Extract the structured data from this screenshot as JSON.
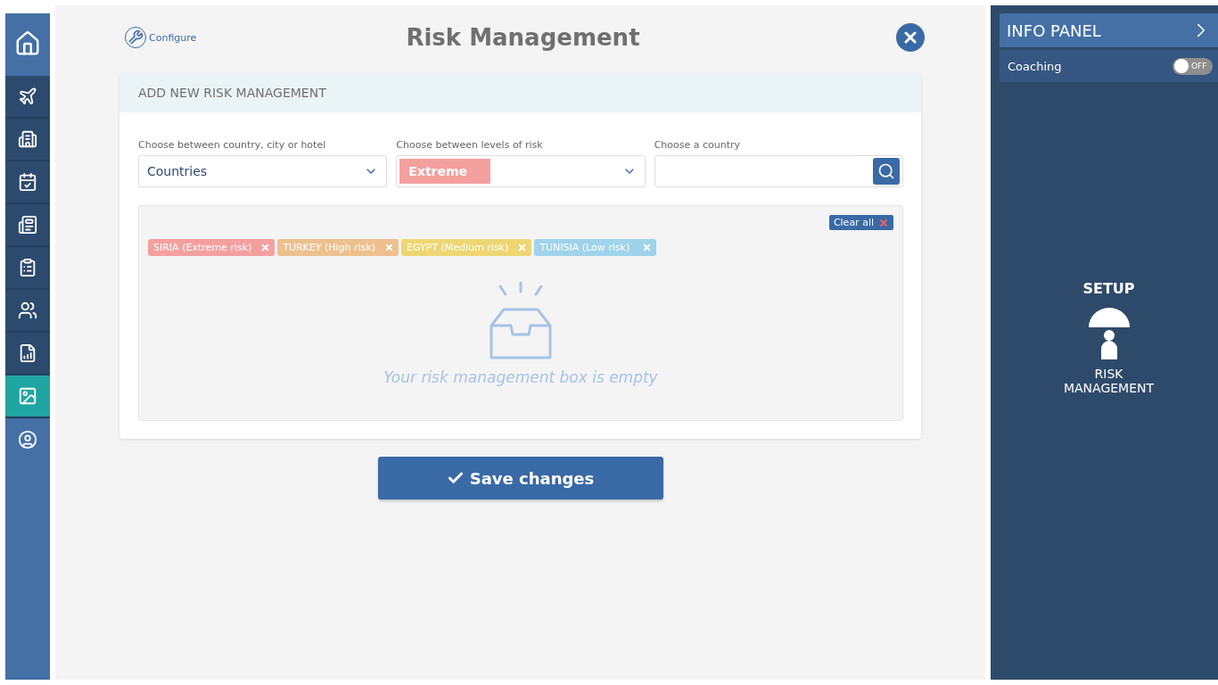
{
  "nav": [
    {
      "kind": "primary",
      "selected": false
    },
    {
      "kind": "section",
      "selected": false
    },
    {
      "kind": "section",
      "selected": false
    },
    {
      "kind": "section",
      "selected": false
    },
    {
      "kind": "section",
      "selected": false
    },
    {
      "kind": "section",
      "selected": false
    },
    {
      "kind": "section",
      "selected": false
    },
    {
      "kind": "section",
      "selected": false
    },
    {
      "kind": "section",
      "selected": true
    },
    {
      "kind": "primary",
      "selected": false
    }
  ],
  "header": {
    "configure": "Configure",
    "title": "Risk Management"
  },
  "card": {
    "title": "ADD NEW RISK MANAGEMENT",
    "fields": [
      {
        "kind": "select",
        "label": "Choose between country, city or hotel",
        "value": "Countries"
      },
      {
        "kind": "chip-select",
        "label": "Choose between levels of risk",
        "value": "Extreme",
        "color": "#f4a09f"
      },
      {
        "kind": "search",
        "label": "Choose a country"
      }
    ],
    "clear_all": "Clear all",
    "tags": [
      {
        "label": "SIRIA (Extreme risk)",
        "color": "#f4a09f"
      },
      {
        "label": "TURKEY (High risk)",
        "color": "#edc08e"
      },
      {
        "label": "EGYPT (Medium risk)",
        "color": "#eed772"
      },
      {
        "label": "TUNISIA (Low risk)",
        "color": "#9fd3ea"
      }
    ],
    "empty_message": "Your risk management box is empty"
  },
  "save_button": "Save changes",
  "info_panel": {
    "title": "INFO PANEL",
    "coaching": {
      "label": "Coaching",
      "on": false,
      "state_text": "OFF"
    },
    "section": "SETUP",
    "module": "RISK MANAGEMENT"
  }
}
